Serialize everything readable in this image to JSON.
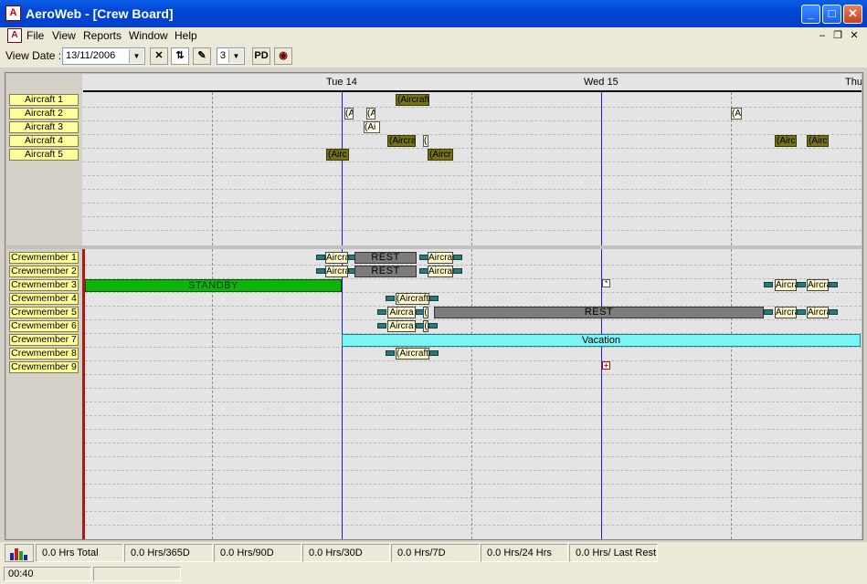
{
  "window": {
    "app_icon": "aeroweb-app-icon",
    "title": "AeroWeb - [Crew Board]",
    "controls": {
      "minimize": "_",
      "maximize": "□",
      "close": "✕"
    }
  },
  "menu": {
    "items": [
      "File",
      "View",
      "Reports",
      "Window",
      "Help"
    ],
    "mdi_controls": {
      "minimize": "–",
      "restore": "❐",
      "close": "✕"
    }
  },
  "toolbar": {
    "view_date_label": "View Date :",
    "view_date_value": "13/11/2006",
    "days_value": "3",
    "buttons": [
      "clear-icon",
      "refresh-icon",
      "wand-icon",
      "pd-icon",
      "camera-icon"
    ],
    "pd_label": "PD"
  },
  "timeline": {
    "days": [
      "Tue 14",
      "Wed 15",
      "Thu"
    ]
  },
  "aircraft_pane": {
    "rows": [
      "Aircraft 1",
      "Aircraft 2",
      "Aircraft 3",
      "Aircraft 4",
      "Aircraft 5"
    ],
    "blocks": [
      {
        "row": 0,
        "label": "(Aircraft",
        "style": "dark"
      },
      {
        "row": 1,
        "label": "(A",
        "style": "light"
      },
      {
        "row": 1,
        "label": "(A",
        "style": "light"
      },
      {
        "row": 1,
        "label": "(A",
        "style": "light"
      },
      {
        "row": 2,
        "label": "(Ai",
        "style": "light"
      },
      {
        "row": 3,
        "label": "(Aircra",
        "style": "dark"
      },
      {
        "row": 3,
        "label": "(",
        "style": "light"
      },
      {
        "row": 3,
        "label": "(Airc",
        "style": "dark"
      },
      {
        "row": 3,
        "label": "(Airc",
        "style": "dark"
      },
      {
        "row": 4,
        "label": "(Airc",
        "style": "dark"
      },
      {
        "row": 4,
        "label": "(Aircr",
        "style": "dark"
      }
    ]
  },
  "crew_pane": {
    "rows": [
      "Crewmember 1",
      "Crewmember 2",
      "Crewmember 3",
      "Crewmember 4",
      "Crewmember 5",
      "Crewmember 6",
      "Crewmember 7",
      "Crewmember 8",
      "Crewmember 9"
    ],
    "rest_label": "REST",
    "standby_label": "STANDBY",
    "vacation_label": "Vacation",
    "aircraft_labels": {
      "c1a": "Aircra",
      "c1b": "Aircra",
      "c2a": "Aircra",
      "c2b": "Aircra",
      "c3a": "Aircra",
      "c3b": "Aircra",
      "c4a": "(Aircraft",
      "c5a": "Aircra",
      "c5b": "(",
      "c5c": "Aircra",
      "c5d": "Aircra",
      "c6a": "Aircra",
      "c6b": "(",
      "c8a": "(Aircraft"
    }
  },
  "status": {
    "chart_icon": "bar-chart-icon",
    "cells": [
      "0.0 Hrs Total",
      "0.0 Hrs/365D",
      "0.0 Hrs/90D",
      "0.0 Hrs/30D",
      "0.0 Hrs/7D",
      "0.0 Hrs/24 Hrs",
      "0.0 Hrs/ Last Rest"
    ],
    "time": "00:40"
  }
}
